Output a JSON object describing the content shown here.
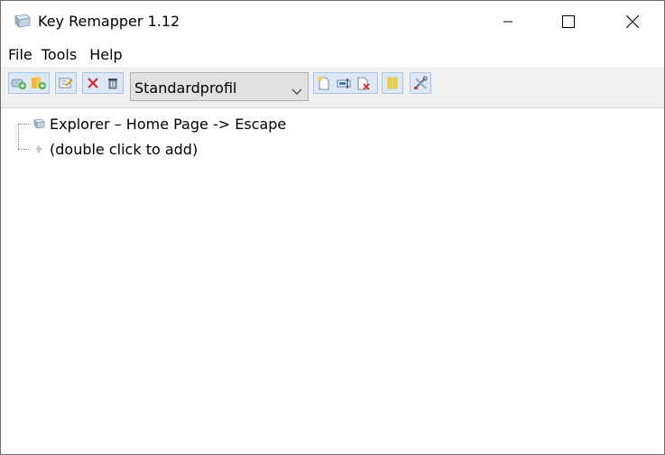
{
  "window": {
    "title": "Key Remapper 1.12"
  },
  "menu": [
    "File",
    "Tools",
    "Help"
  ],
  "toolbar": {
    "profile": "Standardprofil"
  },
  "tree": {
    "items": [
      {
        "label": "Explorer – Home Page -> Escape"
      },
      {
        "label": "(double click to add)"
      }
    ]
  }
}
